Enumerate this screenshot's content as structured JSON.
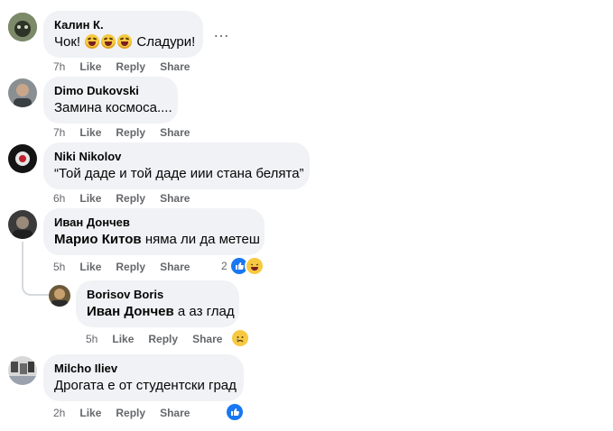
{
  "actions": {
    "like": "Like",
    "reply": "Reply",
    "share": "Share"
  },
  "comments": [
    {
      "name": "Калин К.",
      "text_before": "Чок! ",
      "emojis": [
        "rofl-emoji",
        "rofl-emoji",
        "rofl-emoji"
      ],
      "text_after": " Сладури!",
      "time": "7h",
      "more": "…"
    },
    {
      "name": "Dimo Dukovski",
      "text": "Замина космоса....",
      "time": "7h"
    },
    {
      "name": "Niki Nikolov",
      "text": "“Той даде и той даде иии стана белята”",
      "time": "6h"
    },
    {
      "name": "Иван Дончев",
      "mention": "Марио Китов",
      "text": " няма ли да метеш",
      "time": "5h",
      "reaction_count": "2",
      "reactions": [
        "like-icon",
        "haha-icon"
      ]
    },
    {
      "name": "Borisov Boris",
      "mention": "Иван Дончев",
      "text": " а аз глад",
      "time": "5h",
      "reactions": [
        "sad-icon"
      ]
    },
    {
      "name": "Milcho Iliev",
      "text": "Дрогата е от студентски град",
      "time": "2h",
      "reactions": [
        "like-icon"
      ]
    }
  ],
  "colors": {
    "bubble": "#f0f2f5",
    "meta": "#65676b",
    "like_blue": "#1877f2",
    "emoji_yellow": "#f7c942"
  }
}
